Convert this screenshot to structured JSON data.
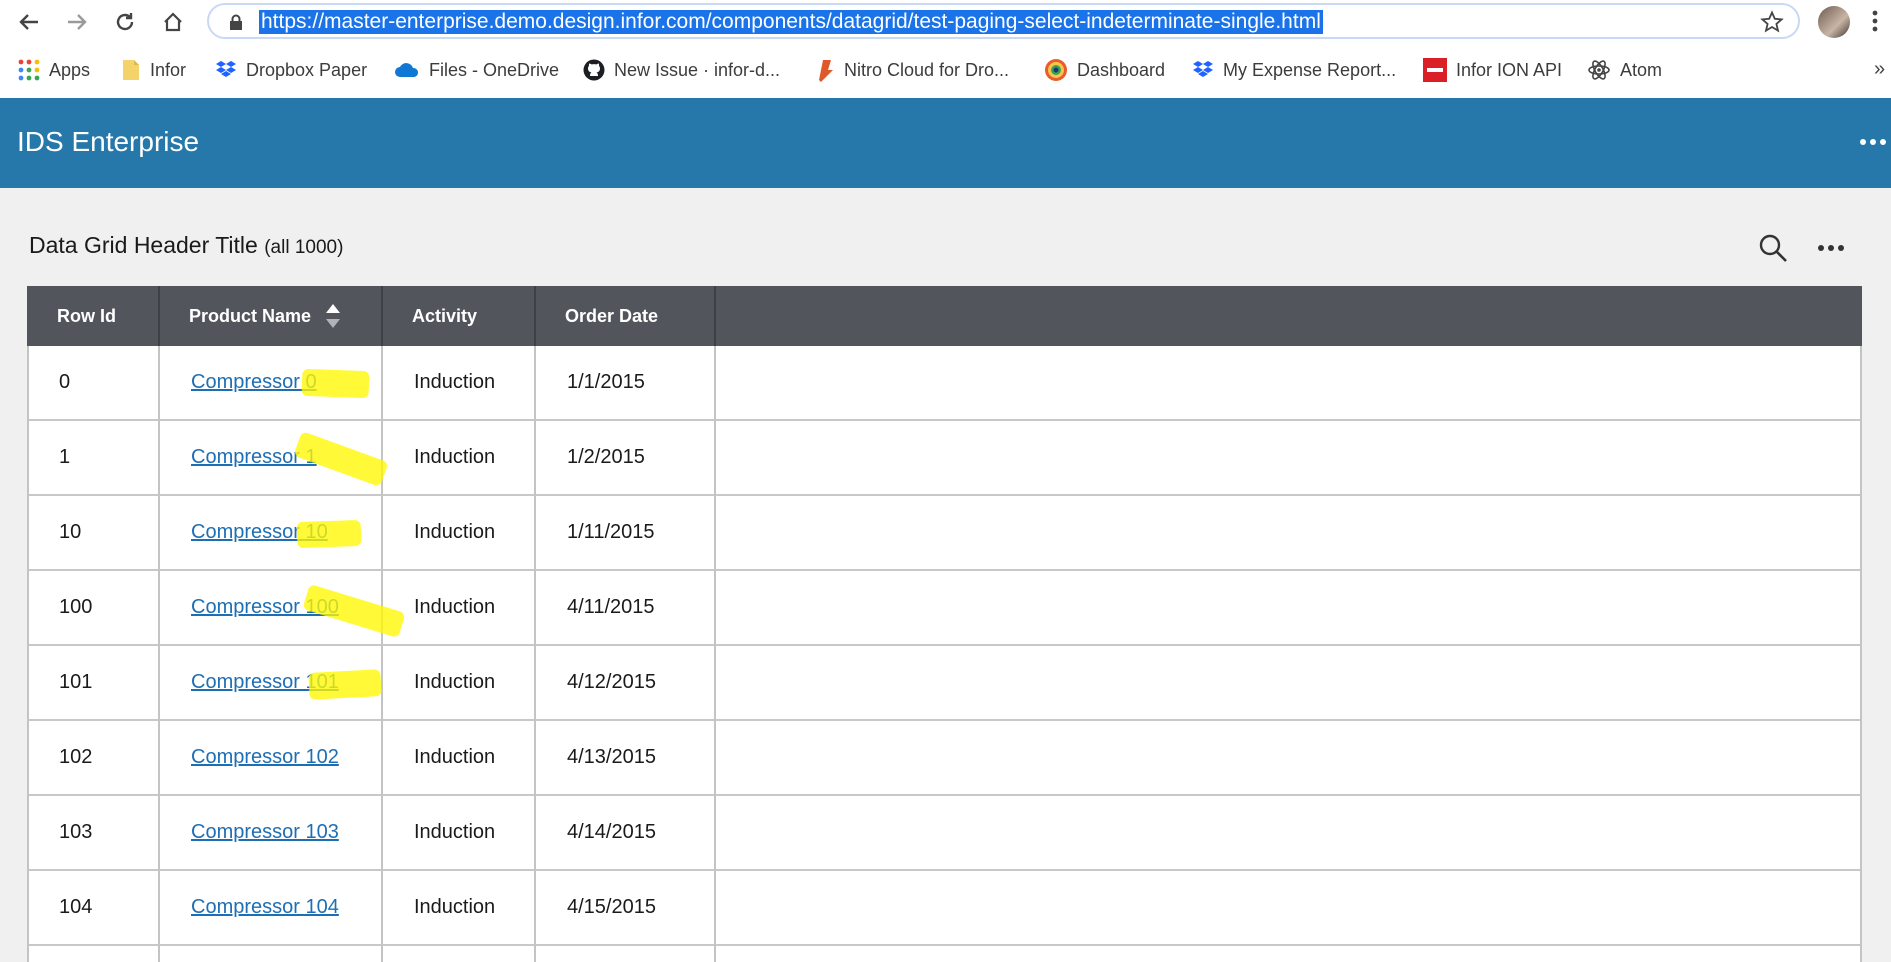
{
  "browser": {
    "url": "https://master-enterprise.demo.design.infor.com/components/datagrid/test-paging-select-indeterminate-single.html",
    "bookmarks": [
      {
        "label": "Apps",
        "icon": "apps-grid-icon"
      },
      {
        "label": "Infor",
        "icon": "folder-icon"
      },
      {
        "label": "Dropbox Paper",
        "icon": "dropbox-icon"
      },
      {
        "label": "Files - OneDrive",
        "icon": "onedrive-icon"
      },
      {
        "label": "New Issue · infor-d...",
        "icon": "github-icon"
      },
      {
        "label": "Nitro Cloud for Dro...",
        "icon": "nitro-icon"
      },
      {
        "label": "Dashboard",
        "icon": "dashboard-icon"
      },
      {
        "label": "My Expense Report...",
        "icon": "dropbox-icon"
      },
      {
        "label": "Infor ION API",
        "icon": "infor-logo-icon"
      },
      {
        "label": "Atom",
        "icon": "atom-icon"
      }
    ],
    "overflow": "»"
  },
  "app": {
    "title": "IDS Enterprise"
  },
  "grid": {
    "title": "Data Grid Header Title",
    "count": "(all 1000)",
    "columns": [
      "Row Id",
      "Product Name",
      "Activity",
      "Order Date"
    ],
    "sorted_column": "Product Name",
    "rows": [
      {
        "id": "0",
        "product": "Compressor 0",
        "activity": "Induction",
        "date": "1/1/2015"
      },
      {
        "id": "1",
        "product": "Compressor 1",
        "activity": "Induction",
        "date": "1/2/2015"
      },
      {
        "id": "10",
        "product": "Compressor 10",
        "activity": "Induction",
        "date": "1/11/2015"
      },
      {
        "id": "100",
        "product": "Compressor 100",
        "activity": "Induction",
        "date": "4/11/2015"
      },
      {
        "id": "101",
        "product": "Compressor 101",
        "activity": "Induction",
        "date": "4/12/2015"
      },
      {
        "id": "102",
        "product": "Compressor 102",
        "activity": "Induction",
        "date": "4/13/2015"
      },
      {
        "id": "103",
        "product": "Compressor 103",
        "activity": "Induction",
        "date": "4/14/2015"
      },
      {
        "id": "104",
        "product": "Compressor 104",
        "activity": "Induction",
        "date": "4/15/2015"
      }
    ]
  },
  "colors": {
    "app_header": "#2578a9",
    "grid_header": "#52555b",
    "link": "#1e6eb4",
    "highlight": "#fff700",
    "url_selection": "#1a73e8"
  }
}
